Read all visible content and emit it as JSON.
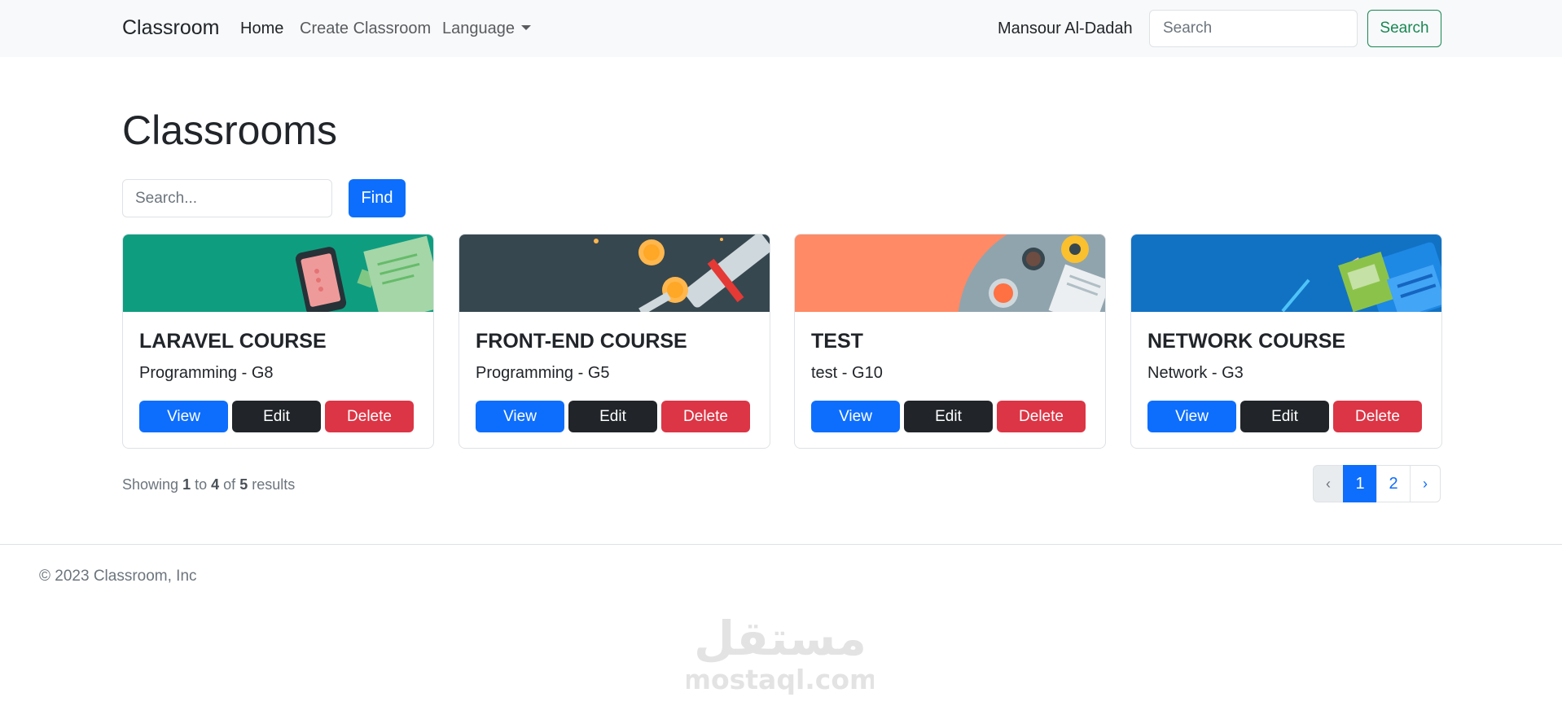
{
  "navbar": {
    "brand": "Classroom",
    "links": [
      "Home",
      "Create Classroom",
      "Language"
    ],
    "user": "Mansour Al-Dadah",
    "search_placeholder": "Search",
    "search_button": "Search"
  },
  "main": {
    "title": "Classrooms",
    "search_placeholder": "Search...",
    "find_button": "Find",
    "classrooms": [
      {
        "name": "LARAVEL COURSE",
        "subtitle": "Programming - G8",
        "view": "View",
        "edit": "Edit",
        "delete": "Delete",
        "banner_color": "#0f9d80"
      },
      {
        "name": "FRONT-END COURSE",
        "subtitle": "Programming - G5",
        "view": "View",
        "edit": "Edit",
        "delete": "Delete",
        "banner_color": "#37474f"
      },
      {
        "name": "TEST",
        "subtitle": "test - G10",
        "view": "View",
        "edit": "Edit",
        "delete": "Delete",
        "banner_color": "#ff8a65"
      },
      {
        "name": "NETWORK COURSE",
        "subtitle": "Network - G3",
        "view": "View",
        "edit": "Edit",
        "delete": "Delete",
        "banner_color": "#1172c4"
      }
    ],
    "results": {
      "prefix": "Showing",
      "from": "1",
      "to_word": "to",
      "to": "4",
      "of_word": "of",
      "total": "5",
      "suffix": "results"
    },
    "pagination": {
      "prev": "‹",
      "pages": [
        "1",
        "2"
      ],
      "current": "1",
      "next": "›"
    }
  },
  "footer": {
    "copyright": "© 2023 Classroom, Inc",
    "watermark_arabic": "مستقل",
    "watermark_latin": "mostaql.com"
  },
  "colors": {
    "primary": "#0d6efd",
    "dark": "#212529",
    "danger": "#dc3545",
    "success": "#198754"
  }
}
